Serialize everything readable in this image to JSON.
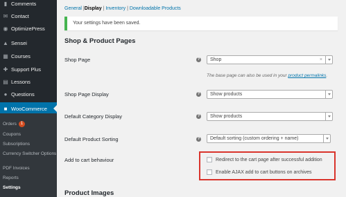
{
  "sidebar": {
    "items": [
      {
        "label": "Comments",
        "icon": "comment-icon"
      },
      {
        "label": "Contact",
        "icon": "envelope-icon"
      },
      {
        "label": "OptimizePress",
        "icon": "optimizepress-icon"
      },
      {
        "label": "Sensei",
        "icon": "graduation-icon"
      },
      {
        "label": "Courses",
        "icon": "courses-icon"
      },
      {
        "label": "Support Plus",
        "icon": "support-icon"
      },
      {
        "label": "Lessons",
        "icon": "lessons-icon"
      },
      {
        "label": "Questions",
        "icon": "question-icon"
      },
      {
        "label": "WooCommerce",
        "icon": "woocommerce-icon"
      }
    ],
    "submenu": {
      "orders_label": "Orders",
      "orders_count": "1",
      "coupons": "Coupons",
      "subscriptions": "Subscriptions",
      "currency_switcher": "Currency Switcher Options",
      "pdf_invoices": "PDF Invoices",
      "reports": "Reports",
      "settings": "Settings"
    }
  },
  "tabs": {
    "general": "General",
    "display": "Display",
    "inventory": "Inventory",
    "downloadable": "Downloadable Products",
    "separator": "|"
  },
  "notice": "Your settings have been saved.",
  "sections": {
    "shop_pages": "Shop & Product Pages",
    "product_images": "Product Images"
  },
  "fields": {
    "shop_page": {
      "label": "Shop Page",
      "value": "Shop",
      "clear": "×"
    },
    "shop_page_desc_prefix": "The base page can also be used in your ",
    "shop_page_desc_link": "product permalinks",
    "shop_page_desc_suffix": ".",
    "shop_page_display": {
      "label": "Shop Page Display",
      "value": "Show products"
    },
    "default_category_display": {
      "label": "Default Category Display",
      "value": "Show products"
    },
    "default_product_sorting": {
      "label": "Default Product Sorting",
      "value": "Default sorting (custom ordering + name)"
    },
    "add_to_cart": {
      "label": "Add to cart behaviour",
      "option1": "Redirect to the cart page after successful addition",
      "option2": "Enable AJAX add to cart buttons on archives"
    },
    "help": "?"
  },
  "colors": {
    "sidebar_bg": "#23282d",
    "submenu_bg": "#32373c",
    "accent": "#0073aa",
    "success": "#46b450",
    "highlight": "#d9332b"
  }
}
